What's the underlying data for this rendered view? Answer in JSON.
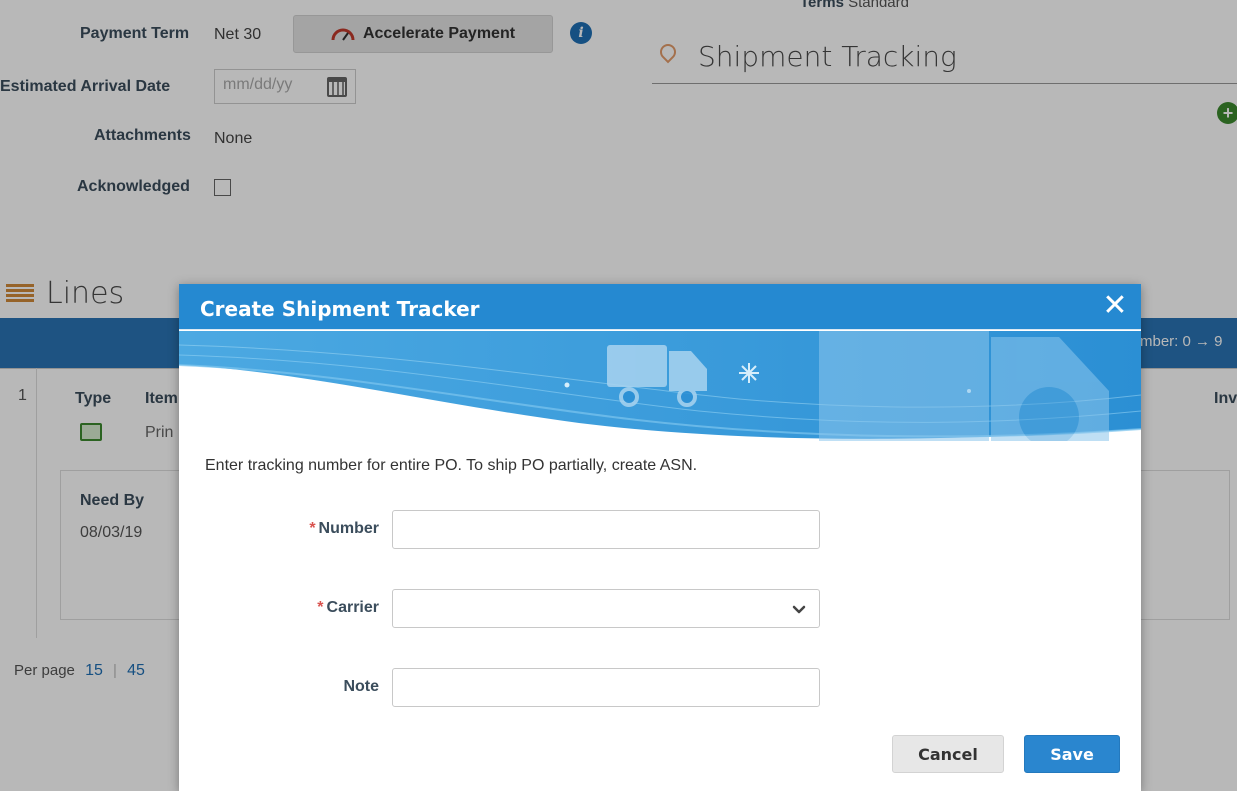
{
  "background": {
    "terms_label": "Terms",
    "terms_value": "Standard",
    "payment_term_label": "Payment Term",
    "payment_term_value": "Net 30",
    "accelerate_button": "Accelerate Payment",
    "estimated_arrival_label": "Estimated Arrival Date",
    "estimated_arrival_placeholder": "mm/dd/yy",
    "attachments_label": "Attachments",
    "attachments_value": "None",
    "acknowledged_label": "Acknowledged",
    "shipment_tracking_title": "Shipment Tracking",
    "lines_title": "Lines",
    "band_right_text": "mber: 0 → 9",
    "row_number": "1",
    "col_type": "Type",
    "col_item": "Item",
    "col_inv": "Inv",
    "item_value": "Prin",
    "need_by_label": "Need By",
    "need_by_value": "08/03/19",
    "per_page_label": "Per page",
    "per_page_options": [
      "15",
      "45"
    ]
  },
  "modal": {
    "title": "Create Shipment Tracker",
    "instruction": "Enter tracking number for entire PO. To ship PO partially, create ASN.",
    "fields": {
      "number": {
        "label": "Number",
        "required_mark": "*",
        "value": ""
      },
      "carrier": {
        "label": "Carrier",
        "required_mark": "*",
        "value": ""
      },
      "note": {
        "label": "Note",
        "value": ""
      }
    },
    "cancel_label": "Cancel",
    "save_label": "Save"
  },
  "colors": {
    "modal_header": "#2589d1",
    "save_button": "#2a86cf",
    "required_asterisk": "#d9534f",
    "accent_blue": "#2a74b5"
  },
  "icons": [
    "speedometer-icon",
    "info-icon",
    "calendar-icon",
    "location-pin-icon",
    "add-icon",
    "close-icon",
    "chevron-down-icon",
    "truck-icon",
    "sparkle-icon"
  ]
}
